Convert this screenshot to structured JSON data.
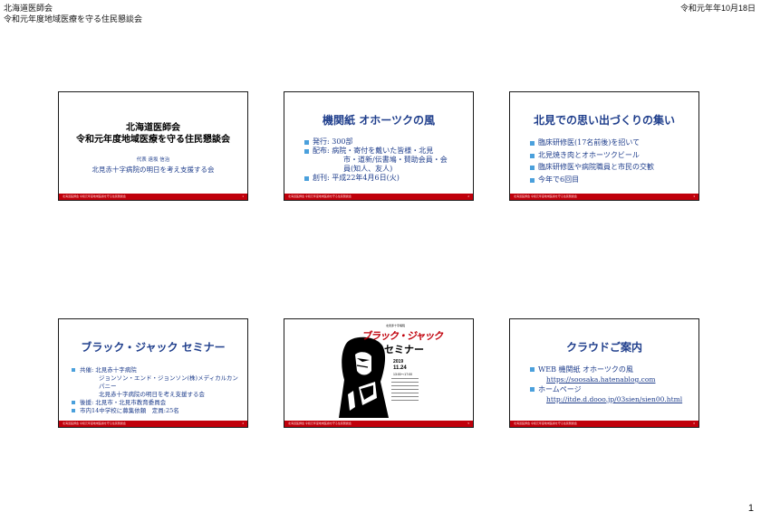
{
  "header": {
    "line1": "北海道医師会",
    "line2": "令和元年度地域医療を守る住民懇談会",
    "date": "令和元年年10月18日"
  },
  "page_number": "1",
  "slide_footer": "北海道医師会 令和元年度地域医療を守る住民懇談会",
  "slides": [
    {
      "title1": "北海道医師会",
      "title2": "令和元年度地域医療を守る住民懇談会",
      "sub1": "代表 遠坂 信治",
      "sub2": "北見赤十字病院の明日を考え支援する会"
    },
    {
      "title": "機関紙 オホーツクの風",
      "items": [
        {
          "text": "発行: 300部"
        },
        {
          "text": "配布: 病院・寄付を戴いた皆様・北見"
        },
        {
          "text": "市・道新/伝書鳩・賛助会員・会",
          "cont": true
        },
        {
          "text": "員(知人、友人)",
          "cont": true
        },
        {
          "text": "創刊: 平成22年4月6日(火)"
        }
      ]
    },
    {
      "title": "北見での思い出づくりの集い",
      "items": [
        "臨床研修医(17名前後)を招いて",
        "北見焼き肉とオホーツクビール",
        "臨床研修医や病院職員と市民の交歓",
        "今年で6回目"
      ]
    },
    {
      "title": "ブラック・ジャック セミナー",
      "items": [
        {
          "text": "共催: 北見赤十字病院"
        },
        {
          "text": "ジョンソン・エンド・ジョンソン(株)メディカルカンパニー",
          "cont": true
        },
        {
          "text": "北見赤十字病院の明日を考え支援する会",
          "cont": true
        },
        {
          "text": "後援: 北見市・北見市教育委員会"
        },
        {
          "text": "市内14中学校に募集依頼　定員:25名"
        }
      ]
    },
    {
      "poster": {
        "org": "北見赤十字病院",
        "title_red": "ブラック・ジャック",
        "title_black": "セミナー",
        "year": "2019",
        "date": "11.24",
        "time": "13:00〜17:00"
      }
    },
    {
      "title": "クラウドご案内",
      "item1": "WEB 機関紙 オホーツクの風",
      "link1": "https://soosaka.hatenablog.com",
      "item2": "ホームページ",
      "link2": "http://itde.d.dooo.jp/03sien/sien00.html"
    }
  ],
  "colors": {
    "title_blue": "#1f3e8c",
    "footer_red": "#c0000b",
    "bullet_blue": "#4aa0dc"
  }
}
